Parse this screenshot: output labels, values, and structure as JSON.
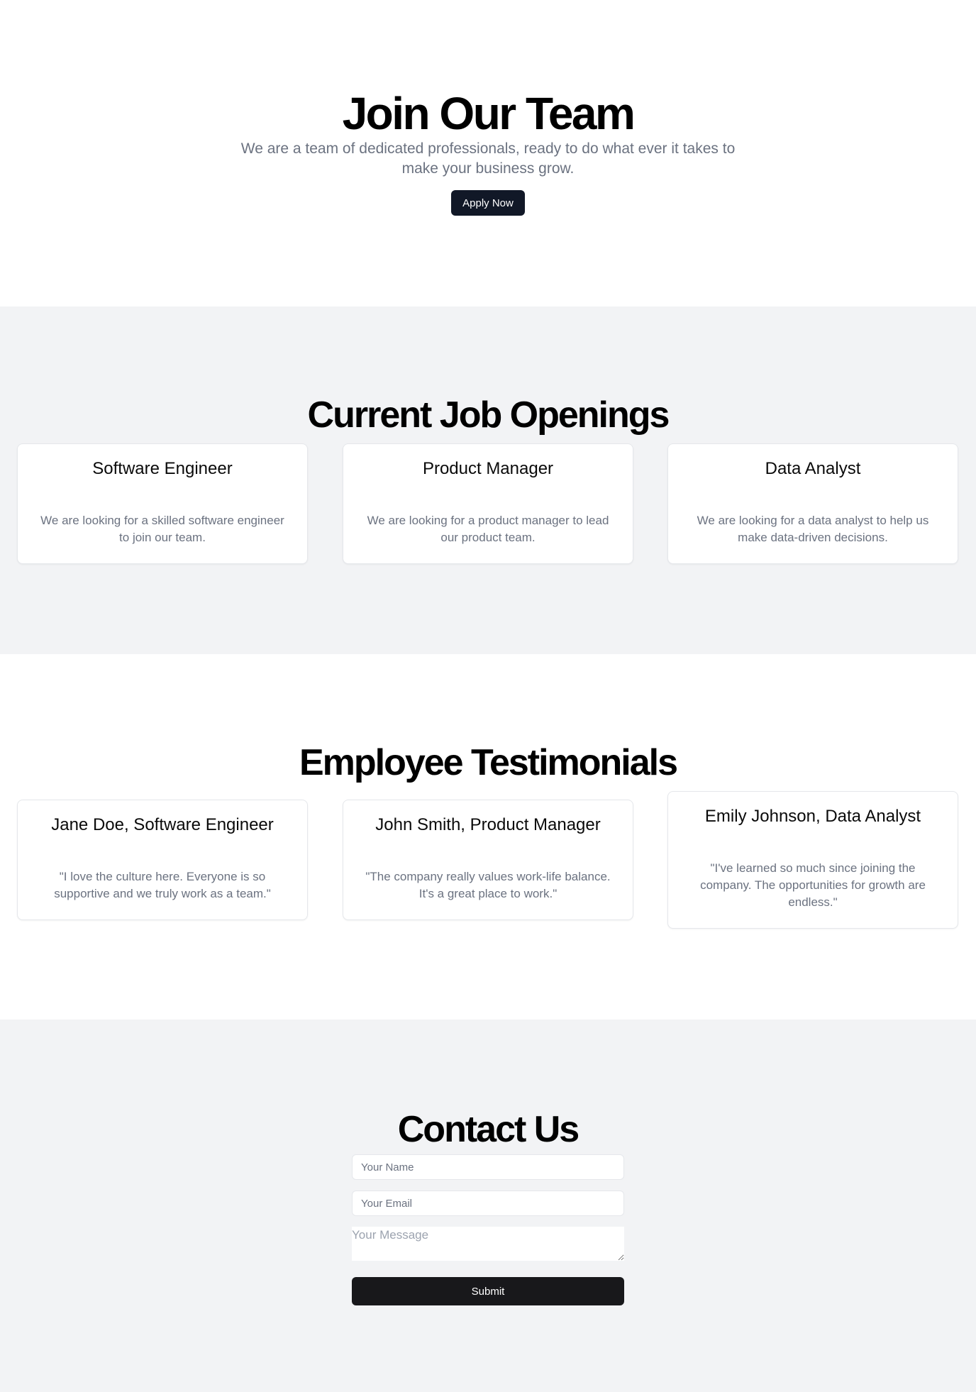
{
  "hero": {
    "title": "Join Our Team",
    "subtitle": "We are a team of dedicated professionals, ready to do what ever it takes to make your business grow.",
    "apply_label": "Apply Now"
  },
  "jobs": {
    "title": "Current Job Openings",
    "items": [
      {
        "title": "Software Engineer",
        "description": "We are looking for a skilled software engineer to join our team."
      },
      {
        "title": "Product Manager",
        "description": "We are looking for a product manager to lead our product team."
      },
      {
        "title": "Data Analyst",
        "description": "We are looking for a data analyst to help us make data-driven decisions."
      }
    ]
  },
  "testimonials": {
    "title": "Employee Testimonials",
    "items": [
      {
        "author": "Jane Doe, Software Engineer",
        "quote": "\"I love the culture here. Everyone is so supportive and we truly work as a team.\""
      },
      {
        "author": "John Smith, Product Manager",
        "quote": "\"The company really values work-life balance. It's a great place to work.\""
      },
      {
        "author": "Emily Johnson, Data Analyst",
        "quote": "\"I've learned so much since joining the company. The opportunities for growth are endless.\""
      }
    ]
  },
  "contact": {
    "title": "Contact Us",
    "name_placeholder": "Your Name",
    "email_placeholder": "Your Email",
    "message_placeholder": "Your Message",
    "submit_label": "Submit"
  },
  "colors": {
    "primary_button": "#111827",
    "submit_button": "#18181b",
    "muted_text": "#6b7280",
    "section_alt_bg": "#f2f3f5"
  }
}
